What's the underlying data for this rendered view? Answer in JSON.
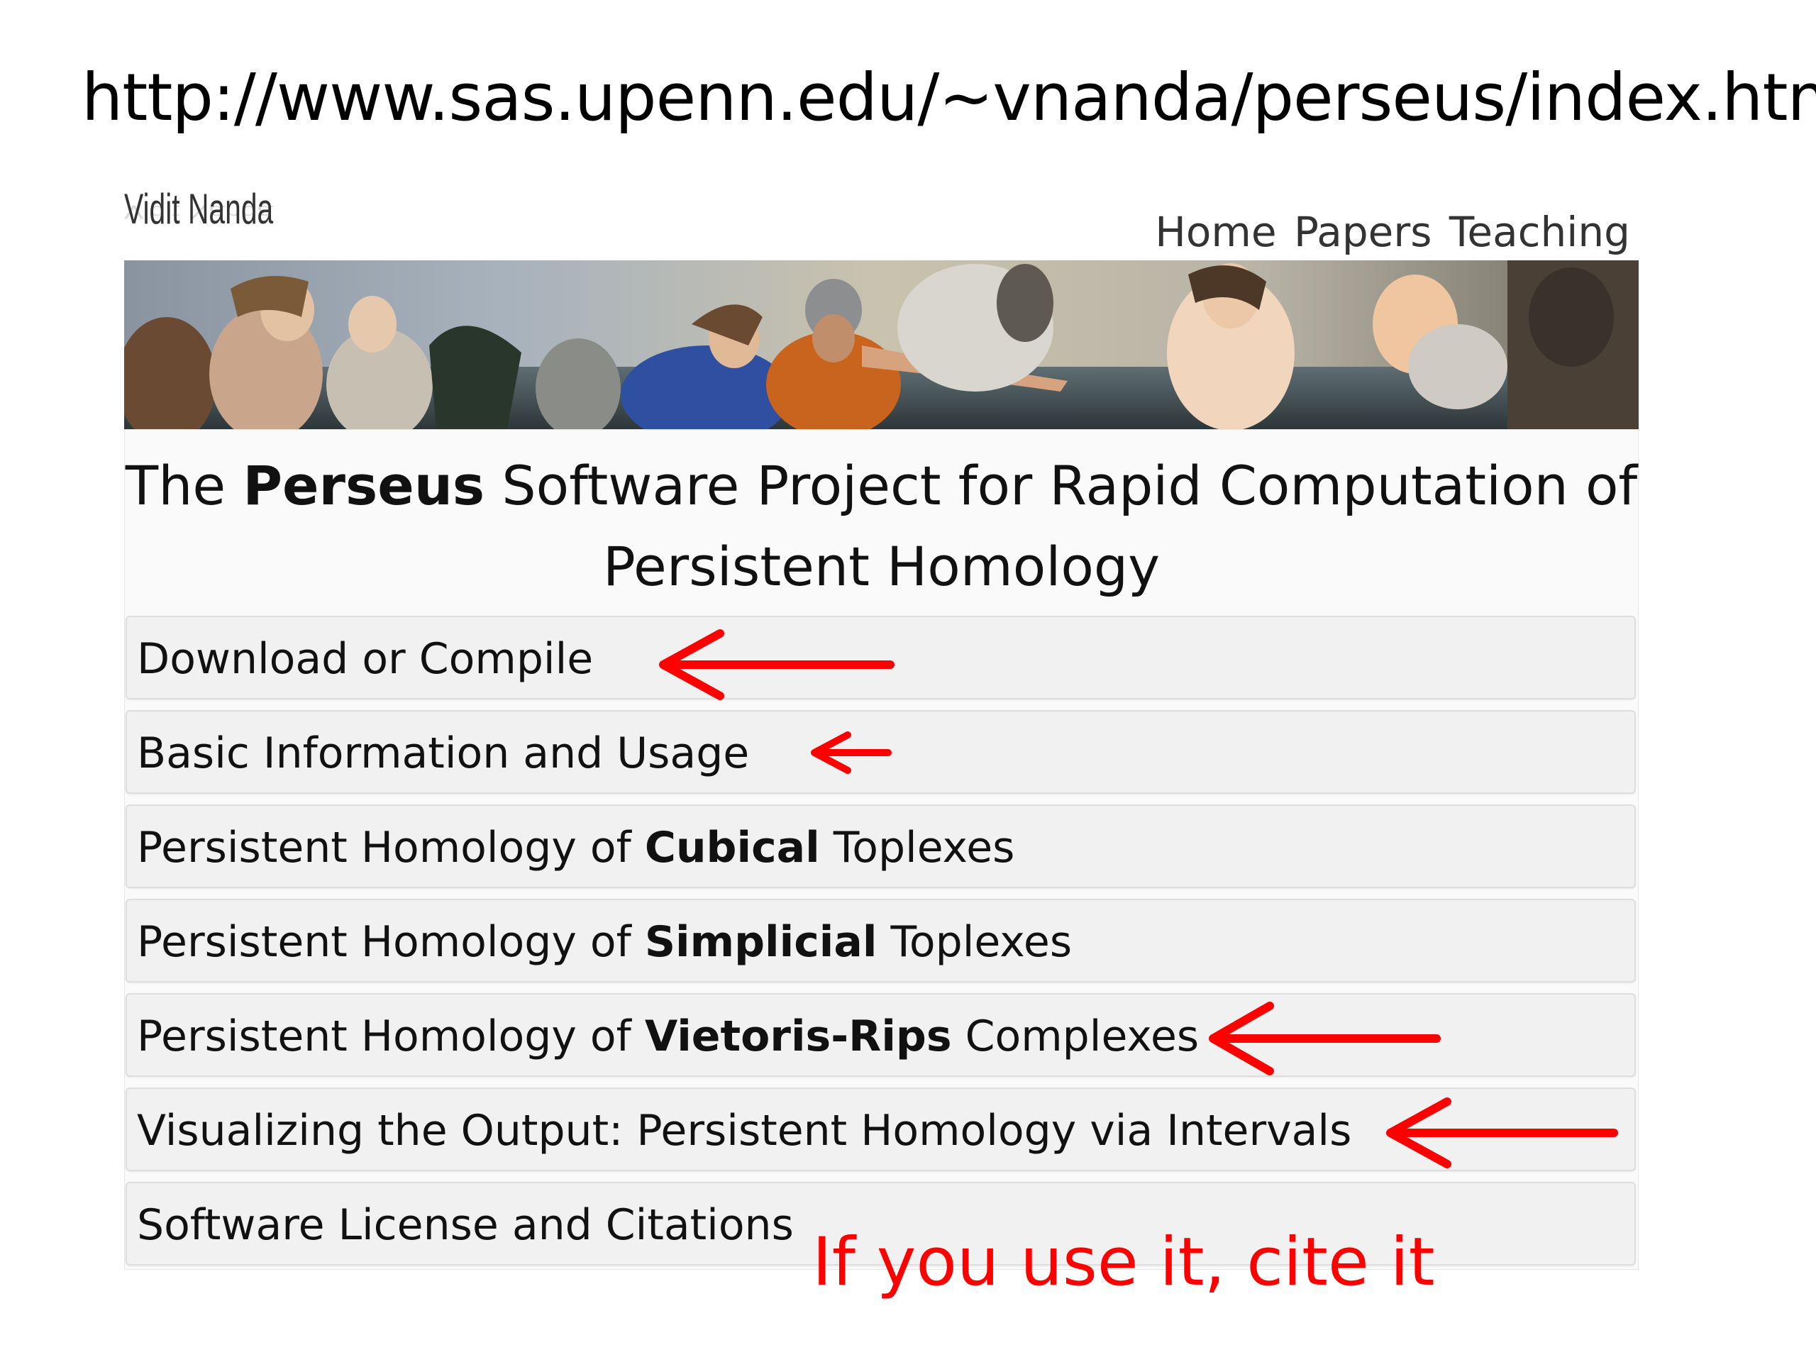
{
  "url_heading": "http://www.sas.upenn.edu/~vnanda/perseus/index.html",
  "site": {
    "name": "Vidit Nanda",
    "nav": [
      {
        "label": "Home"
      },
      {
        "label": "Papers"
      },
      {
        "label": "Teaching"
      }
    ],
    "banner_alt": "",
    "title_part1": "The ",
    "title_bold": "Perseus",
    "title_part2": " Software Project for Rapid Computation of",
    "title_line2": "Persistent Homology"
  },
  "sections": [
    {
      "pre": "Download or Compile",
      "bold": "",
      "post": "",
      "arrow": "long"
    },
    {
      "pre": "Basic Information and Usage",
      "bold": "",
      "post": "",
      "arrow": "short"
    },
    {
      "pre": "Persistent Homology of ",
      "bold": "Cubical",
      "post": " Toplexes",
      "arrow": "none"
    },
    {
      "pre": "Persistent Homology of ",
      "bold": "Simplicial",
      "post": " Toplexes",
      "arrow": "none"
    },
    {
      "pre": "Persistent Homology of ",
      "bold": "Vietoris-Rips",
      "post": " Complexes",
      "arrow": "long"
    },
    {
      "pre": "Visualizing the Output: Persistent Homology via Intervals",
      "bold": "",
      "post": "",
      "arrow": "long"
    },
    {
      "pre": "Software License and Citations",
      "bold": "",
      "post": "",
      "arrow": "none"
    }
  ],
  "annotation": "If you use it, cite it",
  "colors": {
    "annotation": "#ff0000",
    "section_bg": "#f1f1f1",
    "panel_bg": "#fafafa"
  },
  "icons": [
    "left-arrow-annotation-icon"
  ]
}
